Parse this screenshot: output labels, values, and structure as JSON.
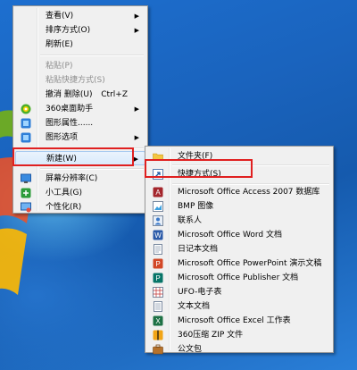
{
  "context_menu": {
    "items": [
      {
        "label": "查看(V)",
        "arrow": "▶"
      },
      {
        "label": "排序方式(O)",
        "arrow": "▶"
      },
      {
        "label": "刷新(E)"
      },
      {
        "label": "粘贴(P)"
      },
      {
        "label": "粘贴快捷方式(S)"
      },
      {
        "label": "撤消 删除(U)",
        "shortcut": "Ctrl+Z"
      },
      {
        "label": "360桌面助手",
        "arrow": "▶"
      },
      {
        "label": "图形属性......"
      },
      {
        "label": "图形选项",
        "arrow": "▶"
      },
      {
        "label": "新建(W)",
        "arrow": "▶"
      },
      {
        "label": "屏幕分辨率(C)"
      },
      {
        "label": "小工具(G)"
      },
      {
        "label": "个性化(R)"
      }
    ]
  },
  "new_submenu": {
    "items": [
      {
        "label": "文件夹(F)"
      },
      {
        "label": "快捷方式(S)"
      },
      {
        "label": "Microsoft Office Access 2007 数据库"
      },
      {
        "label": "BMP 图像"
      },
      {
        "label": "联系人"
      },
      {
        "label": "Microsoft Office Word 文档"
      },
      {
        "label": "日记本文档"
      },
      {
        "label": "Microsoft Office PowerPoint 演示文稿"
      },
      {
        "label": "Microsoft Office Publisher 文档"
      },
      {
        "label": "UFO-电子表"
      },
      {
        "label": "文本文档"
      },
      {
        "label": "Microsoft Office Excel 工作表"
      },
      {
        "label": "360压缩 ZIP 文件"
      },
      {
        "label": "公文包"
      }
    ]
  },
  "colors": {
    "highlight_border": "#e02020",
    "menu_bg": "#f0f0f0",
    "disabled_text": "#8d8d8d"
  }
}
